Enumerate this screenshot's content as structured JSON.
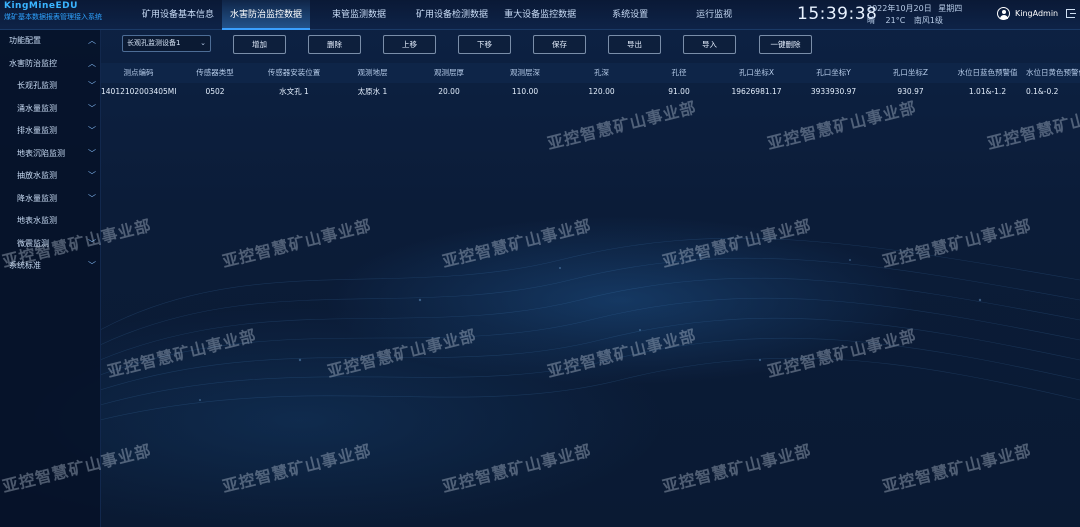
{
  "brand": {
    "name": "KingMineEDU",
    "subtitle": "煤矿基本数据报表管理接入系统"
  },
  "nav": {
    "tabs": [
      {
        "label": "矿用设备基本信息"
      },
      {
        "label": "水害防治监控数据"
      },
      {
        "label": "束管监测数据"
      },
      {
        "label": "矿用设备检测数据"
      },
      {
        "label": "重大设备监控数据"
      },
      {
        "label": "系统设置"
      },
      {
        "label": "运行监视"
      }
    ],
    "active_index": 1
  },
  "status": {
    "time": "15:39:38",
    "date": "2022年10月20日",
    "weekday": "星期四",
    "weather": "晴",
    "temperature": "21°C",
    "wind": "南风1级"
  },
  "user": {
    "name": "KingAdmin"
  },
  "sidebar": {
    "items": [
      {
        "label": "功能配置",
        "level": 1,
        "chevron": "︿"
      },
      {
        "label": "水害防治监控",
        "level": 1,
        "chevron": "︿"
      },
      {
        "label": "长观孔监测",
        "level": 2,
        "chevron": "﹀"
      },
      {
        "label": "涌水量监测",
        "level": 2,
        "chevron": "﹀"
      },
      {
        "label": "排水量监测",
        "level": 2,
        "chevron": "﹀"
      },
      {
        "label": "地表沉陷监测",
        "level": 2,
        "chevron": "﹀"
      },
      {
        "label": "抽放水监测",
        "level": 2,
        "chevron": "﹀"
      },
      {
        "label": "降水量监测",
        "level": 2,
        "chevron": "﹀"
      },
      {
        "label": "地表水监测",
        "level": 2,
        "chevron": ""
      },
      {
        "label": "微震监测",
        "level": 2,
        "chevron": "﹀"
      },
      {
        "label": "系统标准",
        "level": 1,
        "chevron": "﹀"
      }
    ]
  },
  "toolbar": {
    "device_select": "长观孔监测设备1",
    "buttons": [
      "增加",
      "删除",
      "上移",
      "下移",
      "保存",
      "导出",
      "导入",
      "一键删除"
    ]
  },
  "table": {
    "headers": [
      "测点编码",
      "传感器类型",
      "传感器安装位置",
      "观测地层",
      "观测层厚",
      "观测层深",
      "孔深",
      "孔径",
      "孔口坐标X",
      "孔口坐标Y",
      "孔口坐标Z",
      "水位日蓝色预警值",
      "水位日黄色预警值"
    ],
    "rows": [
      [
        "14012102003405MI",
        "0502",
        "水文孔 1",
        "太原水 1",
        "20.00",
        "110.00",
        "120.00",
        "91.00",
        "19626981.17",
        "3933930.97",
        "930.97",
        "1.01&-1.2",
        "0.1&-0.2"
      ]
    ]
  },
  "watermark": "亚控智慧矿山事业部"
}
